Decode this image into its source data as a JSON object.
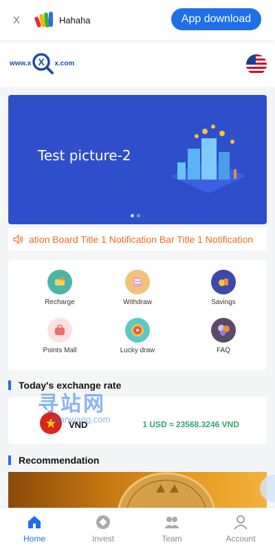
{
  "download_bar": {
    "close_label": "X",
    "app_name": "Hahaha",
    "button_label": "App download"
  },
  "header": {
    "brand_left": "www.x",
    "brand_mid": "X",
    "brand_right": "x.com",
    "language_flag": "us-flag-icon"
  },
  "banner": {
    "title": "Test picture-2",
    "active_dot": 1,
    "dot_count": 2
  },
  "notice": {
    "icon": "speaker-icon",
    "text": "ation Board Title 1 Notification Bar Title 1 Notification"
  },
  "menu": {
    "items": [
      {
        "label": "Recharge",
        "icon": "recharge-icon",
        "color": "#4cb6a6"
      },
      {
        "label": "Withdraw",
        "icon": "withdraw-icon",
        "color": "#f1c27a"
      },
      {
        "label": "Savings",
        "icon": "savings-icon",
        "color": "#3b4aa8"
      },
      {
        "label": "Points Mall",
        "icon": "points-mall-icon",
        "color": "#f08a8a"
      },
      {
        "label": "Lucky draw",
        "icon": "lucky-draw-icon",
        "color": "#5dc8c9"
      },
      {
        "label": "FAQ",
        "icon": "faq-icon",
        "color": "#5a4a6a"
      }
    ]
  },
  "exchange": {
    "heading": "Today's exchange rate",
    "currency": "VND",
    "rate": "1 USD ≈ 23568.3246 VND"
  },
  "watermark": {
    "big": "寻站网",
    "small": "zhanwang.com"
  },
  "recommendation": {
    "heading": "Recommendation"
  },
  "tabbar": {
    "tabs": [
      {
        "label": "Home",
        "active": true
      },
      {
        "label": "Invest",
        "active": false
      },
      {
        "label": "Team",
        "active": false
      },
      {
        "label": "Account",
        "active": false
      }
    ]
  },
  "colors": {
    "accent": "#1e6fe8",
    "notice": "#ef6c1a",
    "rate": "#2fa86b",
    "banner": "#2f4ec9"
  }
}
